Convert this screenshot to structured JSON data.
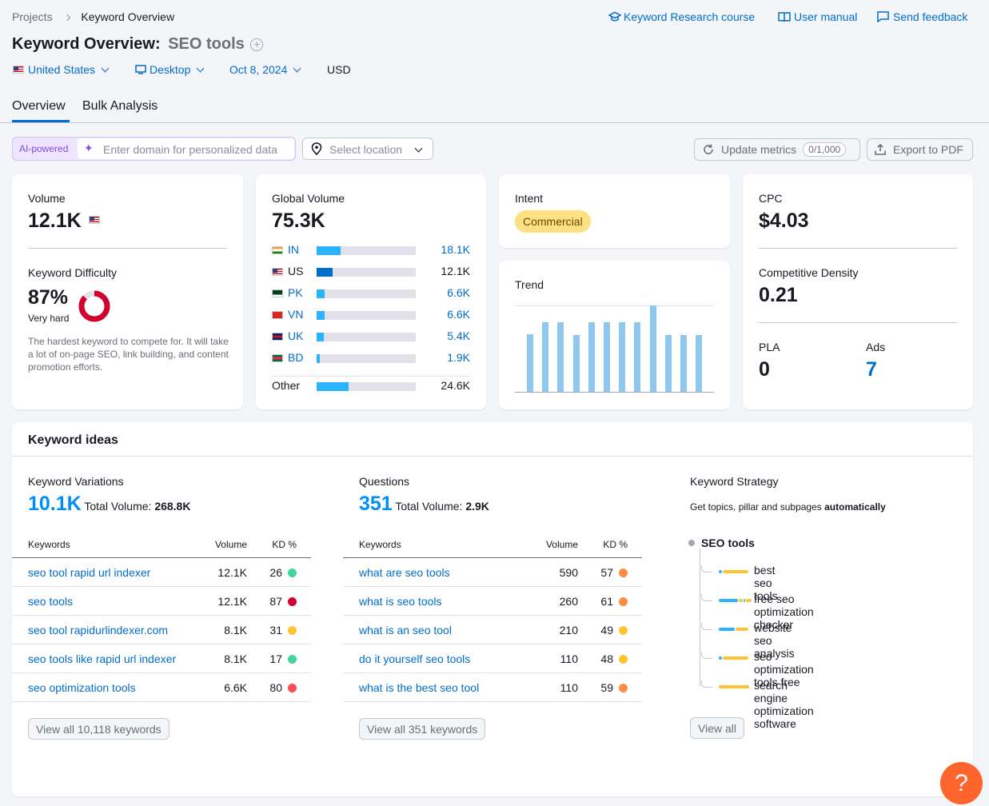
{
  "breadcrumb": {
    "root": "Projects",
    "current": "Keyword Overview"
  },
  "top_links": {
    "course": "Keyword Research course",
    "manual": "User manual",
    "feedback": "Send feedback"
  },
  "title": {
    "prefix": "Keyword Overview:",
    "keyword": "SEO tools"
  },
  "filters": {
    "country": "United States",
    "device": "Desktop",
    "date": "Oct 8, 2024",
    "currency": "USD"
  },
  "tabs": [
    "Overview",
    "Bulk Analysis"
  ],
  "toolbar": {
    "ai_badge": "AI-powered",
    "domain_placeholder": "Enter domain for personalized data",
    "location_placeholder": "Select location",
    "update_label": "Update metrics",
    "update_count": "0/1,000",
    "export_label": "Export to PDF"
  },
  "volume": {
    "label": "Volume",
    "value": "12.1K"
  },
  "difficulty": {
    "label": "Keyword Difficulty",
    "value": "87%",
    "level": "Very hard",
    "percent": 87,
    "description": "The hardest keyword to compete for. It will take a lot of on-page SEO, link building, and content promotion efforts."
  },
  "global_volume": {
    "label": "Global Volume",
    "value": "75.3K",
    "countries": [
      {
        "code": "IN",
        "value": "18.1K",
        "share": 0.24
      },
      {
        "code": "US",
        "value": "12.1K",
        "share": 0.16
      },
      {
        "code": "PK",
        "value": "6.6K",
        "share": 0.08
      },
      {
        "code": "VN",
        "value": "6.6K",
        "share": 0.08
      },
      {
        "code": "UK",
        "value": "5.4K",
        "share": 0.07
      },
      {
        "code": "BD",
        "value": "1.9K",
        "share": 0.03
      }
    ],
    "other_label": "Other",
    "other_value": "24.6K",
    "other_share": 0.32
  },
  "intent": {
    "label": "Intent",
    "value": "Commercial"
  },
  "trend": {
    "label": "Trend",
    "values": [
      0.67,
      0.81,
      0.81,
      0.66,
      0.81,
      0.81,
      0.81,
      0.81,
      1.0,
      0.66,
      0.66,
      0.66
    ]
  },
  "cpc": {
    "label": "CPC",
    "value": "$4.03"
  },
  "density": {
    "label": "Competitive Density",
    "value": "0.21"
  },
  "pla": {
    "label": "PLA",
    "value": "0"
  },
  "ads": {
    "label": "Ads",
    "value": "7"
  },
  "ideas": {
    "title": "Keyword ideas",
    "variations": {
      "label": "Keyword Variations",
      "count": "10.1K",
      "total_label": "Total Volume:",
      "total": "268.8K",
      "headers": [
        "Keywords",
        "Volume",
        "KD %"
      ],
      "rows": [
        {
          "kw": "seo tool rapid url indexer",
          "vol": "12.1K",
          "kd": "26",
          "color": "#3fd59b"
        },
        {
          "kw": "seo tools",
          "vol": "12.1K",
          "kd": "87",
          "color": "#d1002f"
        },
        {
          "kw": "seo tool rapidurlindexer.com",
          "vol": "8.1K",
          "kd": "31",
          "color": "#ffc531"
        },
        {
          "kw": "seo tools like rapid url indexer",
          "vol": "8.1K",
          "kd": "17",
          "color": "#3fd59b"
        },
        {
          "kw": "seo optimization tools",
          "vol": "6.6K",
          "kd": "80",
          "color": "#ff4953"
        }
      ],
      "view_all": "View all 10,118 keywords"
    },
    "questions": {
      "label": "Questions",
      "count": "351",
      "total_label": "Total Volume:",
      "total": "2.9K",
      "headers": [
        "Keywords",
        "Volume",
        "KD %"
      ],
      "rows": [
        {
          "kw": "what are seo tools",
          "vol": "590",
          "kd": "57",
          "color": "#ff8c43"
        },
        {
          "kw": "what is seo tools",
          "vol": "260",
          "kd": "61",
          "color": "#ff8c43"
        },
        {
          "kw": "what is an seo tool",
          "vol": "210",
          "kd": "49",
          "color": "#ffc531"
        },
        {
          "kw": "do it yourself seo tools",
          "vol": "110",
          "kd": "48",
          "color": "#ffc531"
        },
        {
          "kw": "what is the best seo tool",
          "vol": "110",
          "kd": "59",
          "color": "#ff8c43"
        }
      ],
      "view_all": "View all 351 keywords"
    },
    "strategy": {
      "label": "Keyword Strategy",
      "desc_prefix": "Get topics, pillar and subpages",
      "desc_bold": "automatically",
      "root": "SEO tools",
      "items": [
        "best seo tools",
        "free seo optimization checker",
        "website seo analysis",
        "seo optimization tools free",
        "search engine optimization software"
      ],
      "view_all": "View all"
    }
  },
  "help": "?"
}
